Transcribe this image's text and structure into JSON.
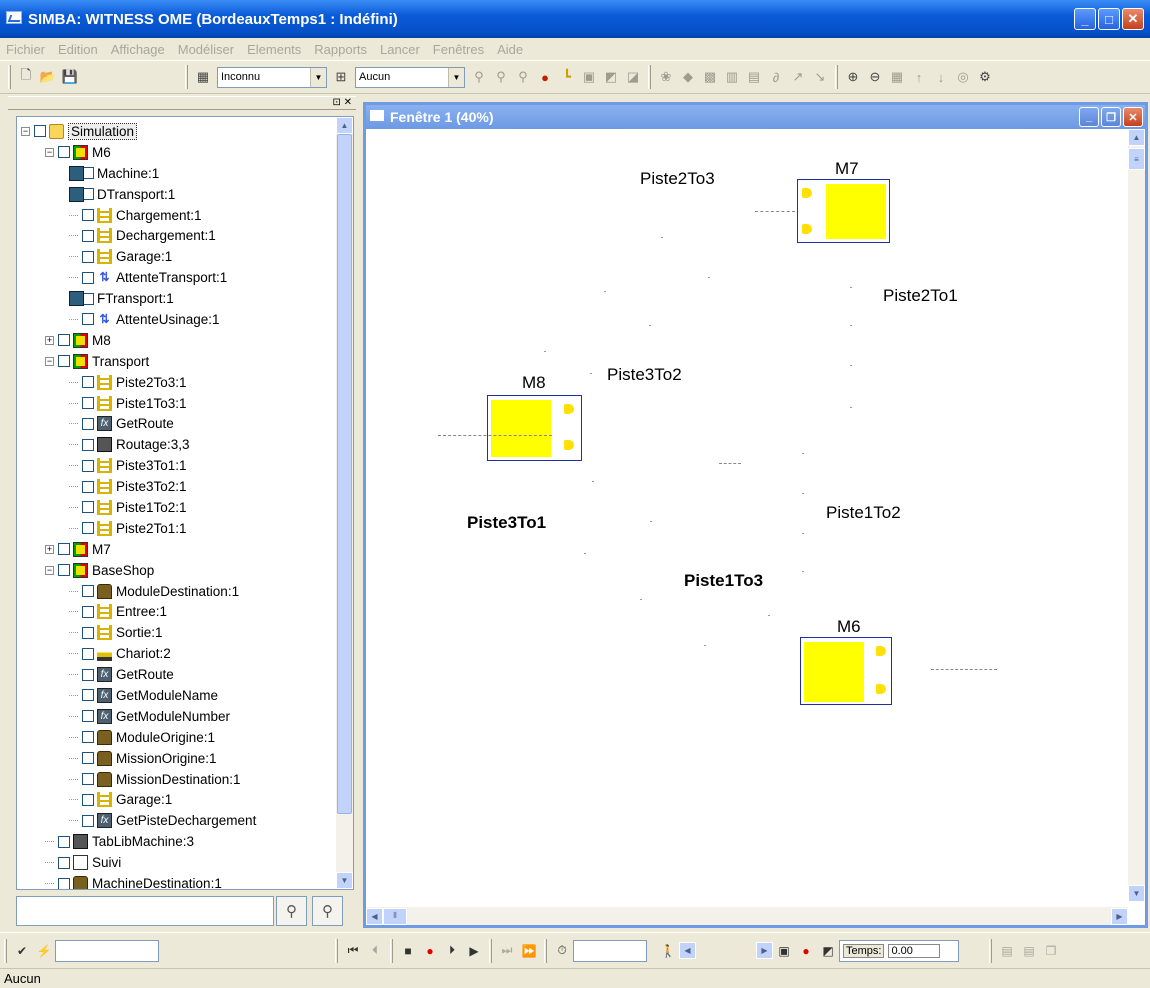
{
  "window": {
    "title": "SIMBA: WITNESS OME (BordeauxTemps1 : Indéfini)",
    "buttons": {
      "minimize": "_",
      "maximize": "□",
      "close": "✕"
    }
  },
  "menu": [
    "Fichier",
    "Edition",
    "Affichage",
    "Modéliser",
    "Elements",
    "Rapports",
    "Lancer",
    "Fenêtres",
    "Aide"
  ],
  "toolbar": {
    "combo1_value": "Inconnu",
    "combo2_value": "Aucun"
  },
  "tree": [
    {
      "label": "Simulation",
      "icon": "folder-icon",
      "level": 0,
      "expander": "−"
    },
    {
      "label": "M6",
      "icon": "module-icon",
      "level": 1,
      "expander": "−"
    },
    {
      "label": "Machine:1",
      "icon": "machine-icon",
      "level": 2,
      "expander": ""
    },
    {
      "label": "DTransport:1",
      "icon": "machine-icon",
      "level": 2,
      "expander": ""
    },
    {
      "label": "Chargement:1",
      "icon": "buffer-icon",
      "level": 2,
      "expander": ""
    },
    {
      "label": "Dechargement:1",
      "icon": "buffer-icon",
      "level": 2,
      "expander": ""
    },
    {
      "label": "Garage:1",
      "icon": "buffer-icon",
      "level": 2,
      "expander": ""
    },
    {
      "label": "AttenteTransport:1",
      "icon": "queue-icon",
      "level": 2,
      "expander": ""
    },
    {
      "label": "FTransport:1",
      "icon": "machine-icon",
      "level": 2,
      "expander": ""
    },
    {
      "label": "AttenteUsinage:1",
      "icon": "queue-icon",
      "level": 2,
      "expander": ""
    },
    {
      "label": "M8",
      "icon": "module-icon",
      "level": 1,
      "expander": "+"
    },
    {
      "label": "Transport",
      "icon": "module-icon",
      "level": 1,
      "expander": "−"
    },
    {
      "label": "Piste2To3:1",
      "icon": "buffer-icon",
      "level": 2,
      "expander": ""
    },
    {
      "label": "Piste1To3:1",
      "icon": "buffer-icon",
      "level": 2,
      "expander": ""
    },
    {
      "label": "GetRoute",
      "icon": "function-icon",
      "level": 2,
      "expander": ""
    },
    {
      "label": "Routage:3,3",
      "icon": "table-icon",
      "level": 2,
      "expander": ""
    },
    {
      "label": "Piste3To1:1",
      "icon": "buffer-icon",
      "level": 2,
      "expander": ""
    },
    {
      "label": "Piste3To2:1",
      "icon": "buffer-icon",
      "level": 2,
      "expander": ""
    },
    {
      "label": "Piste1To2:1",
      "icon": "buffer-icon",
      "level": 2,
      "expander": ""
    },
    {
      "label": "Piste2To1:1",
      "icon": "buffer-icon",
      "level": 2,
      "expander": ""
    },
    {
      "label": "M7",
      "icon": "module-icon",
      "level": 1,
      "expander": "+"
    },
    {
      "label": "BaseShop",
      "icon": "module-icon",
      "level": 1,
      "expander": "−"
    },
    {
      "label": "ModuleDestination:1",
      "icon": "variable-icon",
      "level": 2,
      "expander": ""
    },
    {
      "label": "Entree:1",
      "icon": "buffer-icon",
      "level": 2,
      "expander": ""
    },
    {
      "label": "Sortie:1",
      "icon": "buffer-icon",
      "level": 2,
      "expander": ""
    },
    {
      "label": "Chariot:2",
      "icon": "chariot-icon",
      "level": 2,
      "expander": ""
    },
    {
      "label": "GetRoute",
      "icon": "function-icon",
      "level": 2,
      "expander": ""
    },
    {
      "label": "GetModuleName",
      "icon": "function-icon",
      "level": 2,
      "expander": ""
    },
    {
      "label": "GetModuleNumber",
      "icon": "function-icon",
      "level": 2,
      "expander": ""
    },
    {
      "label": "ModuleOrigine:1",
      "icon": "variable-icon",
      "level": 2,
      "expander": ""
    },
    {
      "label": "MissionOrigine:1",
      "icon": "variable-icon",
      "level": 2,
      "expander": ""
    },
    {
      "label": "MissionDestination:1",
      "icon": "variable-icon",
      "level": 2,
      "expander": ""
    },
    {
      "label": "Garage:1",
      "icon": "buffer-icon",
      "level": 2,
      "expander": ""
    },
    {
      "label": "GetPisteDechargement",
      "icon": "function-icon",
      "level": 2,
      "expander": ""
    },
    {
      "label": "TabLibMachine:3",
      "icon": "table-icon",
      "level": 1,
      "expander": ""
    },
    {
      "label": "Suivi",
      "icon": "document-icon",
      "level": 1,
      "expander": ""
    },
    {
      "label": "MachineDestination:1",
      "icon": "variable-icon",
      "level": 1,
      "expander": ""
    }
  ],
  "model_window": {
    "title": "Fenêtre 1 (40%)",
    "labels": {
      "piste2to3": "Piste2To3",
      "piste2to1": "Piste2To1",
      "piste3to2": "Piste3To2",
      "piste3to1": "Piste3To1",
      "piste1to2": "Piste1To2",
      "piste1to3": "Piste1To3"
    },
    "machines": {
      "m7": "M7",
      "m8": "M8",
      "m6": "M6"
    }
  },
  "bottom": {
    "time_label": "Temps:",
    "time_value": "0.00"
  },
  "status": "Aucun",
  "colors": {
    "titlebar": "#0A5BD8",
    "machine_fill": "#FFFF00",
    "machine_border": "#2030A0"
  }
}
